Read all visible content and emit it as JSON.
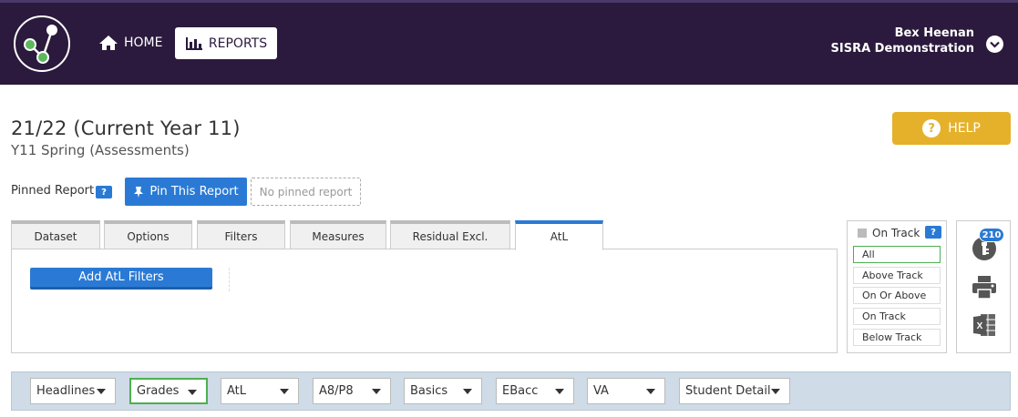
{
  "header": {
    "nav": {
      "home_label": "HOME",
      "reports_label": "REPORTS"
    },
    "user": {
      "name": "Bex Heenan",
      "org": "SISRA Demonstration"
    },
    "colors": {
      "background": "#2b1a3d"
    }
  },
  "page": {
    "year_title": "21/22 (Current Year 11)",
    "assessment_title": "Y11 Spring (Assessments)",
    "help_label": "HELP"
  },
  "pinned": {
    "label": "Pinned Report",
    "help_badge": "?",
    "pin_button_label": "Pin This Report",
    "no_pinned_label": "No pinned report"
  },
  "tabs": [
    {
      "label": "Dataset"
    },
    {
      "label": "Options"
    },
    {
      "label": "Filters"
    },
    {
      "label": "Measures"
    },
    {
      "label": "Residual Excl."
    },
    {
      "label": "AtL",
      "active": true
    }
  ],
  "atl_panel": {
    "add_button_label": "Add AtL Filters"
  },
  "track": {
    "header_label": "On Track",
    "help_badge": "?",
    "options": [
      {
        "label": "All",
        "selected": true
      },
      {
        "label": "Above Track"
      },
      {
        "label": "On Or Above"
      },
      {
        "label": "On Track"
      },
      {
        "label": "Below Track"
      }
    ]
  },
  "tools": {
    "filter_count": "210",
    "icons": [
      "filter-key-icon",
      "printer-icon",
      "excel-icon"
    ]
  },
  "report_bar": {
    "dropdowns": [
      {
        "label": "Headlines"
      },
      {
        "label": "Grades",
        "active": true
      },
      {
        "label": "AtL"
      },
      {
        "label": "A8/P8"
      },
      {
        "label": "Basics"
      },
      {
        "label": "EBacc"
      },
      {
        "label": "VA"
      },
      {
        "label": "Student Detail"
      }
    ]
  },
  "colors": {
    "primary_blue": "#2a7ad5",
    "help_gold": "#e6b12a",
    "active_green": "#4caf50",
    "bar_blue_gray": "#cfdbe6"
  }
}
